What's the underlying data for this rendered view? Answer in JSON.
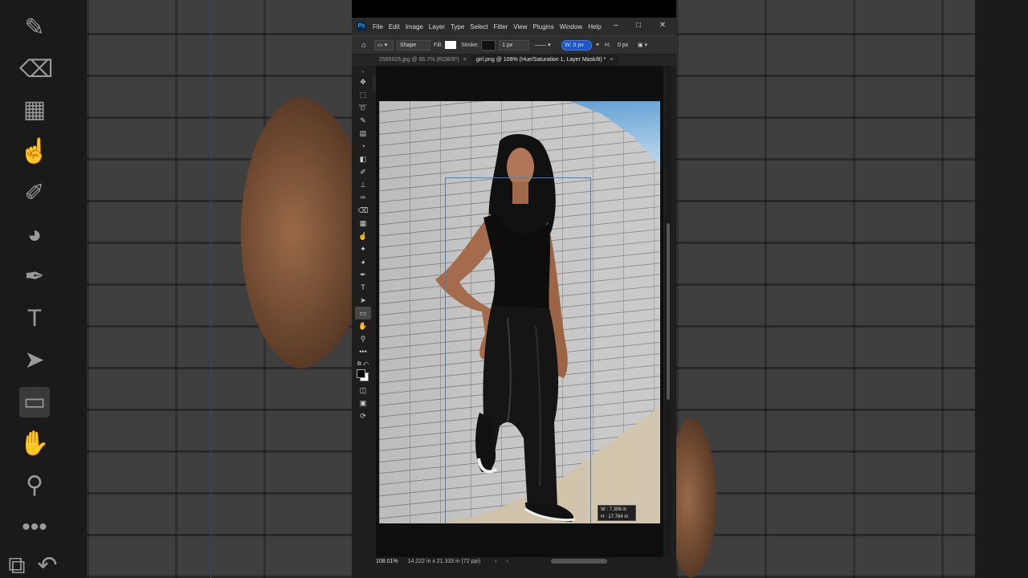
{
  "app": {
    "menu": [
      "File",
      "Edit",
      "Image",
      "Layer",
      "Type",
      "Select",
      "Filter",
      "View",
      "Plugins",
      "Window",
      "Help"
    ]
  },
  "options": {
    "mode": "Shape",
    "fill_label": "Fill:",
    "stroke_label": "Stroke:",
    "stroke_width": "1 px",
    "w_field": "W: 0 px",
    "h_field": "0 px"
  },
  "tabs": [
    {
      "label": "2566025.jpg @ 66.7% (RGB/8*)"
    },
    {
      "label": "girl.png @ 108% (Hue/Saturation 1, Layer Mask/8) *"
    }
  ],
  "dimension_tooltip": {
    "w": "W :   7.306 in",
    "h": "H :   17.764 in"
  },
  "status": {
    "zoom": "108.01%",
    "doc_size": "14.222 in x 21.333 in (72 ppi)"
  }
}
